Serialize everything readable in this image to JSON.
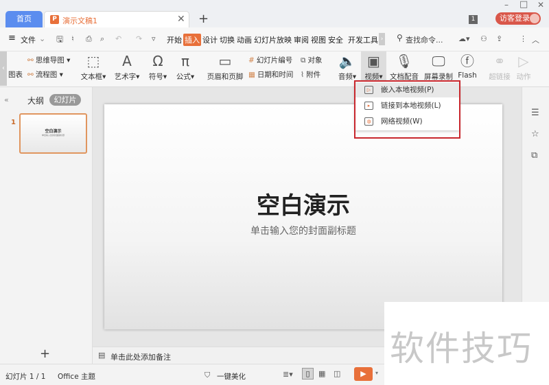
{
  "titlebar": {
    "home_tab": "首页",
    "doc_tab": "演示文稿1",
    "doc_icon": "P",
    "new_tab": "+",
    "badge": "1",
    "login": "访客登录",
    "min": "–",
    "max": "□",
    "close": "✕"
  },
  "menu": {
    "file": "文件",
    "tabs": [
      "开始",
      "插入",
      "设计",
      "切换",
      "动画",
      "幻灯片放映",
      "审阅",
      "视图",
      "安全",
      "开发工具"
    ],
    "active_tab": "插入",
    "search": "查找命令..."
  },
  "ribbon": {
    "chart": "图表",
    "mindmap": "思维导图",
    "flowchart": "流程图",
    "textbox": "文本框",
    "wordart": "艺术字",
    "symbol": "符号",
    "formula": "公式",
    "header_footer": "页眉和页脚",
    "slide_number": "幻灯片编号",
    "datetime": "日期和时间",
    "object": "对象",
    "attachment": "附件",
    "audio": "音频",
    "video": "视频",
    "doc_dub": "文档配音",
    "screen_record": "屏幕录制",
    "flash": "Flash",
    "hyperlink": "超链接",
    "action": "动作"
  },
  "video_menu": {
    "items": [
      "嵌入本地视频(P)",
      "链接到本地视频(L)",
      "网络视频(W)"
    ]
  },
  "left_panel": {
    "outline_tab": "大纲",
    "slides_tab": "幻灯片",
    "slide_index": "1",
    "add": "+"
  },
  "slide": {
    "title": "空白演示",
    "subtitle": "单击输入您的封面副标题"
  },
  "notes": {
    "placeholder": "单击此处添加备注"
  },
  "status": {
    "slide_count": "幻灯片 1 / 1",
    "theme": "Office 主题",
    "beautify": "一键美化"
  },
  "watermark": "软件技巧",
  "colors": {
    "accent": "#e8703a",
    "home_tab": "#5b8def",
    "login": "#d9574a",
    "highlight_box": "#c8262c"
  }
}
